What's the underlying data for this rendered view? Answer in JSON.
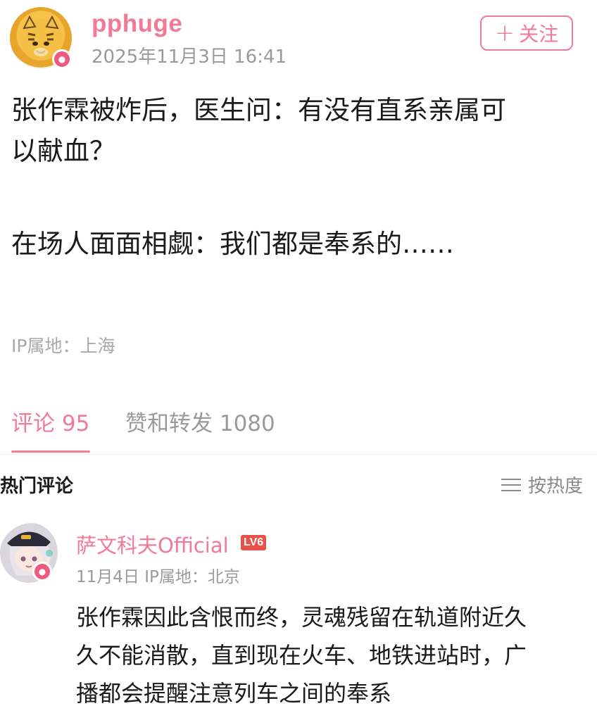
{
  "post": {
    "username": "pphuge",
    "date": "2025年11月3日 16:41",
    "follow_label": "关注",
    "follow_plus": "+",
    "lines": [
      "张作霖被炸后，医生问：有没有直系亲属可",
      "以献血？",
      "在场人面面相觑：我们都是奉系的……"
    ],
    "ip_location": "IP属地：上海"
  },
  "tabs": [
    {
      "label": "评论 95",
      "active": true
    },
    {
      "label": "赞和转发 1080",
      "active": false
    }
  ],
  "hot_comments": {
    "title": "热门评论",
    "sort_label": "按热度"
  },
  "comment": {
    "username": "萨文科夫Official",
    "level": "LV6",
    "meta": "11月4日 IP属地：北京",
    "lines": [
      "张作霖因此含恨而终，灵魂残留在轨道附近久",
      "久不能消散，直到现在火车、地铁进站时，广",
      "播都会提醒注意列车之间的奉系"
    ]
  },
  "icons": {
    "user_avatar": "tiger-avatar-icon",
    "commenter_avatar": "anime-girl-avatar-icon",
    "sort": "menu-lines-icon"
  },
  "colors": {
    "accent": "#f27a97",
    "badge": "#f0587d",
    "level": "#e8524a"
  }
}
